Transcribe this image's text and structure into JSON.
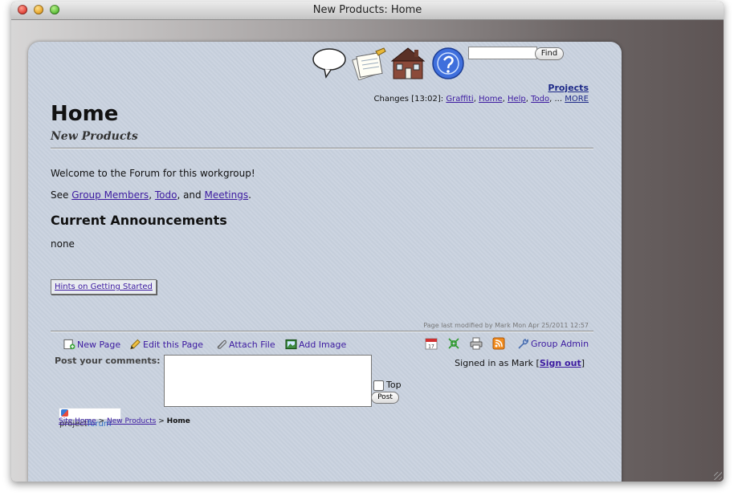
{
  "window": {
    "title": "New Products: Home"
  },
  "search": {
    "placeholder": "",
    "value": "",
    "button_label": "Find"
  },
  "toolbar_icons": [
    "speech-bubble-icon",
    "notepad-pencil-icon",
    "house-icon",
    "help-icon"
  ],
  "header": {
    "projects_link": "Projects",
    "changes_label": "Changes [13:02]:",
    "changes_links": [
      "Graffiti",
      "Home",
      "Help",
      "Todo"
    ],
    "changes_ellipsis": "...",
    "more_link": "MORE"
  },
  "page": {
    "title": "Home",
    "subtitle": "New Products",
    "welcome": "Welcome to the Forum for this workgroup!",
    "see_prefix": "See",
    "see_links": [
      "Group Members",
      "Todo",
      "Meetings"
    ],
    "see_sep1": ",",
    "see_sep2": ", and",
    "see_end": ".",
    "announcements_heading": "Current Announcements",
    "announcements_body": "none",
    "hints_button": "Hints on Getting Started",
    "last_modified": "Page last modified by Mark Mon Apr 25/2011 12:57"
  },
  "actions": {
    "new_page": "New Page",
    "edit_page": "Edit this Page",
    "attach_file": "Attach File",
    "add_image": "Add Image",
    "group_admin": "Group Admin"
  },
  "right_tools": [
    "calendar-icon",
    "sync-arrows-icon",
    "printer-icon",
    "rss-feed-icon"
  ],
  "comments": {
    "label": "Post your comments:",
    "value": "",
    "top_label": "Top",
    "top_checked": false,
    "post_button": "Post"
  },
  "signin": {
    "prefix": "Signed in as Mark [",
    "sign_out": "Sign out",
    "suffix": "]"
  },
  "footer": {
    "logo_part1": "project",
    "logo_part2": "forum",
    "breadcrumb": [
      "Site Home",
      "New Products",
      "Home"
    ],
    "breadcrumb_sep": ">"
  },
  "colors": {
    "link": "#3c1aa0",
    "card_bg": "#c9d2df",
    "window_bg": "#767070"
  }
}
